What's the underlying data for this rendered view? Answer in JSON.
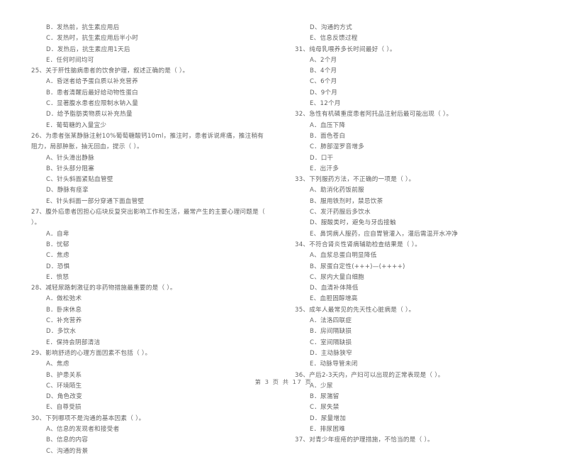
{
  "document": {
    "type": "scanned-exam-paper",
    "page_footer": "第 3 页  共 17 页"
  },
  "left_column": [
    {
      "kind": "option",
      "text": "B．发热前，抗生素应用后"
    },
    {
      "kind": "option",
      "text": "C．发热时，抗生素应用后半小时"
    },
    {
      "kind": "option",
      "text": "D．发热后，抗生素应用1天后"
    },
    {
      "kind": "option",
      "text": "E．任何时间均可"
    },
    {
      "kind": "stem",
      "text": "25、关于肝性脑病患者的饮食护理，叙述正确的是（    ）。"
    },
    {
      "kind": "option",
      "text": "A．昏迷者给予蛋白质以补充营养"
    },
    {
      "kind": "option",
      "text": "B．患者清醒后最好给动物性蛋白"
    },
    {
      "kind": "option",
      "text": "C．显著腹水患者应限制水钠入量"
    },
    {
      "kind": "option",
      "text": "D．给予脂肪类物质以补充热量"
    },
    {
      "kind": "option",
      "text": "E．葡萄糖的入量宜少"
    },
    {
      "kind": "stem",
      "text": "26、为患者张某静脉注射10%葡萄糖酸钙10ml，推注时，患者诉说疼痛，推注稍有阻力，局部肿胀，抽无回血，提示（    ）。"
    },
    {
      "kind": "option",
      "text": "A、针头滑出静脉"
    },
    {
      "kind": "option",
      "text": "B、针头部分阻塞"
    },
    {
      "kind": "option",
      "text": "C、针头斜面紧贴血管壁"
    },
    {
      "kind": "option",
      "text": "D、静脉有痉挛"
    },
    {
      "kind": "option",
      "text": "E、针头斜面一部分穿通下面血管壁"
    },
    {
      "kind": "stem",
      "text": "27、腹外疝患者因担心疝块反复突出影响工作和生活，最常产生的主要心理问题是（    ）。"
    },
    {
      "kind": "option",
      "text": "A．自卑"
    },
    {
      "kind": "option",
      "text": "B．忧郁"
    },
    {
      "kind": "option",
      "text": "C．焦虑"
    },
    {
      "kind": "option",
      "text": "D．恐惧"
    },
    {
      "kind": "option",
      "text": "E．愤怒"
    },
    {
      "kind": "stem",
      "text": "28、减轻尿路刺激征的非药物措施最重要的是（    ）。"
    },
    {
      "kind": "option",
      "text": "A．做松弛术"
    },
    {
      "kind": "option",
      "text": "B．卧床休息"
    },
    {
      "kind": "option",
      "text": "C．补充营养"
    },
    {
      "kind": "option",
      "text": "D．多饮水"
    },
    {
      "kind": "option",
      "text": "E．保持会阴部清洁"
    },
    {
      "kind": "stem",
      "text": "29、影响舒适的心理方面因素不包括（    ）。"
    },
    {
      "kind": "option",
      "text": "A、焦虑"
    },
    {
      "kind": "option",
      "text": "B、护患关系"
    },
    {
      "kind": "option",
      "text": "C、环境陌生"
    },
    {
      "kind": "option",
      "text": "D、角色改变"
    },
    {
      "kind": "option",
      "text": "E、自尊受损"
    },
    {
      "kind": "stem",
      "text": "30、下列哪项不是沟通的基本因素（    ）。"
    },
    {
      "kind": "option",
      "text": "A、信息的发现者和接受者"
    },
    {
      "kind": "option",
      "text": "B、信息的内容"
    },
    {
      "kind": "option",
      "text": "C、沟通的背景"
    }
  ],
  "right_column": [
    {
      "kind": "option",
      "text": "D、沟通的方式"
    },
    {
      "kind": "option",
      "text": "E、信息反馈过程"
    },
    {
      "kind": "stem",
      "text": "31、纯母乳喂养多长时间最好（    ）。"
    },
    {
      "kind": "option",
      "text": "A、2个月"
    },
    {
      "kind": "option",
      "text": "B、4个月"
    },
    {
      "kind": "option",
      "text": "C、6个月"
    },
    {
      "kind": "option",
      "text": "D、9个月"
    },
    {
      "kind": "option",
      "text": "E、12个月"
    },
    {
      "kind": "stem",
      "text": "32、急性有机磷重度患者阿托品注射后最可能出现（    ）。"
    },
    {
      "kind": "option",
      "text": "A．血压下降"
    },
    {
      "kind": "option",
      "text": "B．面色苍白"
    },
    {
      "kind": "option",
      "text": "C．肺部湿罗音增多"
    },
    {
      "kind": "option",
      "text": "D．口干"
    },
    {
      "kind": "option",
      "text": "E．出汗多"
    },
    {
      "kind": "stem",
      "text": "33、下列服药方法，不正确的一项是（    ）。"
    },
    {
      "kind": "option",
      "text": "A、助消化药饭前服"
    },
    {
      "kind": "option",
      "text": "B、服用铁剂时，禁忌饮茶"
    },
    {
      "kind": "option",
      "text": "C、发汗药服后多饮水"
    },
    {
      "kind": "option",
      "text": "D、服酸类时，避免与牙齿接触"
    },
    {
      "kind": "option",
      "text": "E、鼻饲病人服药，应自胃管灌入，灌后需温开水冲净"
    },
    {
      "kind": "stem",
      "text": "34、不符合肾炎性肾病辅助检查结果是（    ）。"
    },
    {
      "kind": "option",
      "text": "A、血浆总蛋白明显降低"
    },
    {
      "kind": "option",
      "text": "B、尿蛋白定性(+++)—(++++)"
    },
    {
      "kind": "option",
      "text": "C、尿内大量白细胞"
    },
    {
      "kind": "option",
      "text": "D、血清补体降低"
    },
    {
      "kind": "option",
      "text": "E、血胆固醇增高"
    },
    {
      "kind": "stem",
      "text": "35、成年人最常见的先天性心脏病是（    ）。"
    },
    {
      "kind": "option",
      "text": "A．法洛四联症"
    },
    {
      "kind": "option",
      "text": "B．房间隔缺损"
    },
    {
      "kind": "option",
      "text": "C．室间隔缺损"
    },
    {
      "kind": "option",
      "text": "D．主动脉狭窄"
    },
    {
      "kind": "option",
      "text": "E．动脉导管未闭"
    },
    {
      "kind": "stem",
      "text": "36、产后2-3天内，产妇可以出现的正常表现是（    ）。"
    },
    {
      "kind": "option",
      "text": "A．少尿"
    },
    {
      "kind": "option",
      "text": "B．尿潴留"
    },
    {
      "kind": "option",
      "text": "C．尿失禁"
    },
    {
      "kind": "option",
      "text": "D．尿量增加"
    },
    {
      "kind": "option",
      "text": "E．排尿困难"
    },
    {
      "kind": "stem",
      "text": "37、对青少年痤疮的护理措施，不恰当的是（    ）。"
    }
  ]
}
